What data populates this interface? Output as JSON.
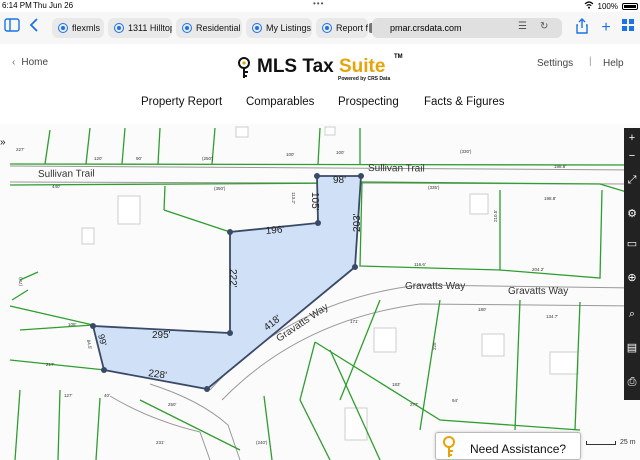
{
  "status_bar": {
    "time": "6:14 PM",
    "date": "Thu Jun 26",
    "battery": "100%"
  },
  "browser": {
    "tabs": [
      {
        "label": "flexmls"
      },
      {
        "label": "1311 Hilltop"
      },
      {
        "label": "Residential"
      },
      {
        "label": "My Listings"
      },
      {
        "label": "Report fo"
      }
    ],
    "url": "pmar.crsdata.com"
  },
  "header": {
    "home_label": "Home",
    "brand_main": "MLS Tax ",
    "brand_accent": "Suite",
    "trademark": "TM",
    "powered_by": "Powered by CRS Data",
    "settings_label": "Settings",
    "separator": "|",
    "help_label": "Help"
  },
  "menu": [
    {
      "label": "Property Report"
    },
    {
      "label": "Comparables"
    },
    {
      "label": "Prospecting"
    },
    {
      "label": "Facts & Figures"
    }
  ],
  "map": {
    "streets": [
      "Sullivan Trail",
      "Sullivan Trail",
      "Gravatts Way",
      "Gravatts Way",
      "Gravatts Way"
    ],
    "parcel_dimensions": [
      "98'",
      "105'",
      "203'",
      "196'",
      "222'",
      "418'",
      "295'",
      "99'",
      "228'"
    ],
    "lot_measurements": [
      "227'",
      "120'",
      "90'",
      "(250')",
      "100'",
      "100'",
      "(330')",
      "198.8'",
      "440'",
      "(350')",
      "113.2'",
      "(335')",
      "198.8'",
      "210.5'",
      "116.6'",
      "204.2'",
      "180'",
      "134.7'",
      "105'",
      "217'",
      "127'",
      "40'",
      "250'",
      "231'",
      "(240')",
      "225'",
      "277'",
      "94'",
      "183'",
      "171'",
      "(75')",
      "84.5'"
    ],
    "scale_label": "25 m",
    "assistance_label": "Need Assistance?"
  },
  "colors": {
    "parcel_fill": "#cfe0f7",
    "parcel_stroke": "#3a4a66",
    "lot_lines": "#2e9e2e",
    "brand_accent": "#e5a50a"
  }
}
